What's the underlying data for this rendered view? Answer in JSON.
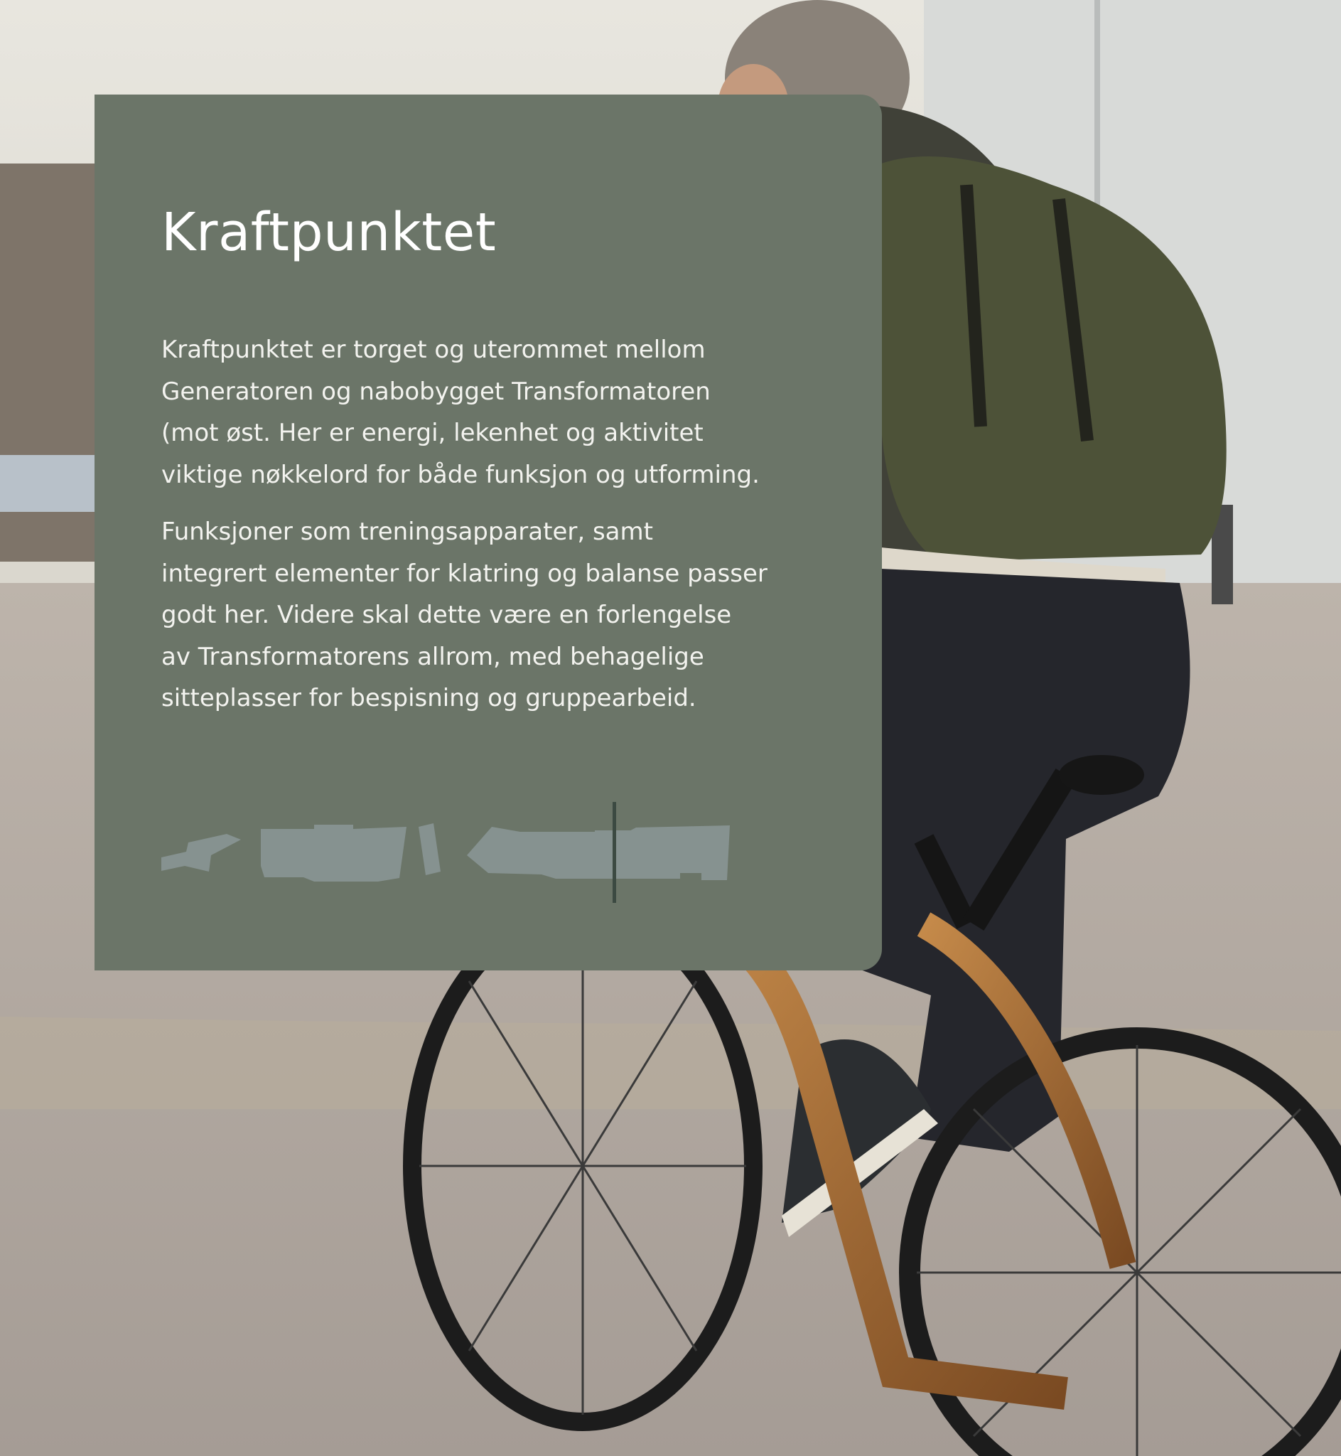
{
  "card": {
    "title": "Kraftpunktet",
    "paragraph_1_lines": [
      "Kraftpunktet er torget og uterommet mellom",
      "Generatoren og nabobygget Transformatoren",
      "(mot øst. Her er energi, lekenhet og aktivitet",
      "viktige nøkkelord for både funksjon og utforming."
    ],
    "paragraph_2_lines": [
      "Funksjoner som treningsapparater, samt",
      "integrert elementer for klatring og balanse passer",
      "godt her. Videre skal dette være en forlengelse",
      "av Transformatorens allrom, med behagelige",
      "sitteplasser for bespisning og gruppearbeid."
    ]
  },
  "colors": {
    "card_background": "#6b7568",
    "text": "#ffffff",
    "site_plan_fill": "#869290",
    "site_plan_marker": "#3c4a42"
  },
  "background_image": "cyclist-with-backpack-on-wooden-bicycle"
}
